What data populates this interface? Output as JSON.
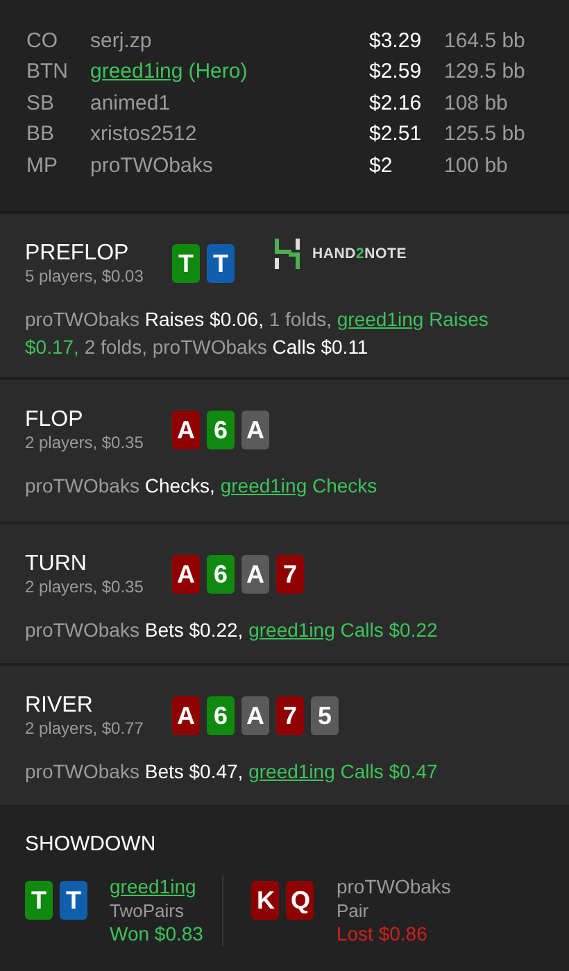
{
  "players": [
    {
      "position": "CO",
      "name": "serj.zp",
      "hero": false,
      "stack": "$3.29",
      "bb": "164.5 bb"
    },
    {
      "position": "BTN",
      "name": "greed1ing",
      "hero": true,
      "hero_tag": "(Hero)",
      "stack": "$2.59",
      "bb": "129.5 bb"
    },
    {
      "position": "SB",
      "name": "animed1",
      "hero": false,
      "stack": "$2.16",
      "bb": "108 bb"
    },
    {
      "position": "BB",
      "name": "xristos2512",
      "hero": false,
      "stack": "$2.51",
      "bb": "125.5 bb"
    },
    {
      "position": "MP",
      "name": "proTWObaks",
      "hero": false,
      "stack": "$2",
      "bb": "100 bb"
    }
  ],
  "streets": [
    {
      "title": "PREFLOP",
      "info": "5 players, $0.03",
      "logo": [
        {
          "text": "HAND",
          "accent": false
        },
        {
          "text": "2",
          "accent": true
        },
        {
          "text": "NOTE",
          "accent": false
        }
      ],
      "cards": [
        {
          "rank": "T",
          "color": "#0f8a0f"
        },
        {
          "rank": "T",
          "color": "#0f5fad"
        }
      ],
      "actions": [
        {
          "kind": "action",
          "player": "proTWObaks",
          "action": "Raises $0.06,",
          "hero": false
        },
        {
          "kind": "folds",
          "text": "1 folds,"
        },
        {
          "kind": "action",
          "player": "greed1ing",
          "action": "Raises $0.17,",
          "hero": true
        },
        {
          "kind": "folds",
          "text": "2 folds,"
        },
        {
          "kind": "action",
          "player": "proTWObaks",
          "action": "Calls $0.11",
          "hero": false
        }
      ]
    },
    {
      "title": "FLOP",
      "info": "2 players, $0.35",
      "cards": [
        {
          "rank": "A",
          "color": "#8f0000"
        },
        {
          "rank": "6",
          "color": "#0f8a0f"
        },
        {
          "rank": "A",
          "color": "#5a5a5a"
        }
      ],
      "actions": [
        {
          "kind": "action",
          "player": "proTWObaks",
          "action": "Checks,",
          "hero": false
        },
        {
          "kind": "action",
          "player": "greed1ing",
          "action": "Checks",
          "hero": true
        }
      ]
    },
    {
      "title": "TURN",
      "info": "2 players, $0.35",
      "cards": [
        {
          "rank": "A",
          "color": "#8f0000"
        },
        {
          "rank": "6",
          "color": "#0f8a0f"
        },
        {
          "rank": "A",
          "color": "#5a5a5a"
        },
        {
          "rank": "7",
          "color": "#8f0000"
        }
      ],
      "actions": [
        {
          "kind": "action",
          "player": "proTWObaks",
          "action": "Bets $0.22,",
          "hero": false
        },
        {
          "kind": "action",
          "player": "greed1ing",
          "action": "Calls $0.22",
          "hero": true
        }
      ]
    },
    {
      "title": "RIVER",
      "info": "2 players, $0.77",
      "cards": [
        {
          "rank": "A",
          "color": "#8f0000"
        },
        {
          "rank": "6",
          "color": "#0f8a0f"
        },
        {
          "rank": "A",
          "color": "#5a5a5a"
        },
        {
          "rank": "7",
          "color": "#8f0000"
        },
        {
          "rank": "5",
          "color": "#5a5a5a"
        }
      ],
      "actions": [
        {
          "kind": "action",
          "player": "proTWObaks",
          "action": "Bets $0.47,",
          "hero": false
        },
        {
          "kind": "action",
          "player": "greed1ing",
          "action": "Calls $0.47",
          "hero": true
        }
      ]
    }
  ],
  "showdown": {
    "title": "SHOWDOWN",
    "hands": [
      {
        "cards": [
          {
            "rank": "T",
            "color": "#0f8a0f"
          },
          {
            "rank": "T",
            "color": "#0f5fad"
          }
        ],
        "player": "greed1ing",
        "hero": true,
        "hand": "TwoPairs",
        "result": "Won $0.83",
        "won": true
      },
      {
        "cards": [
          {
            "rank": "K",
            "color": "#8f0000"
          },
          {
            "rank": "Q",
            "color": "#8f0000"
          }
        ],
        "player": "proTWObaks",
        "hero": false,
        "hand": "Pair",
        "result": "Lost $0.86",
        "won": false
      }
    ]
  }
}
